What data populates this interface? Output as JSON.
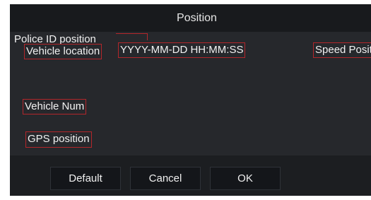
{
  "dialog": {
    "title": "Position"
  },
  "overlays": {
    "police_id": "Police ID position",
    "vehicle_location": "Vehicle location",
    "datetime": "YYYY-MM-DD HH:MM:SS",
    "speed": "Speed Position",
    "vehicle_num": "Vehicle Num",
    "gps": "GPS position"
  },
  "buttons": {
    "default_label": "Default",
    "cancel_label": "Cancel",
    "ok_label": "OK"
  },
  "colors": {
    "overlay_border": "#b3262b",
    "background": "#1f2226",
    "text": "#f2f2f2"
  }
}
